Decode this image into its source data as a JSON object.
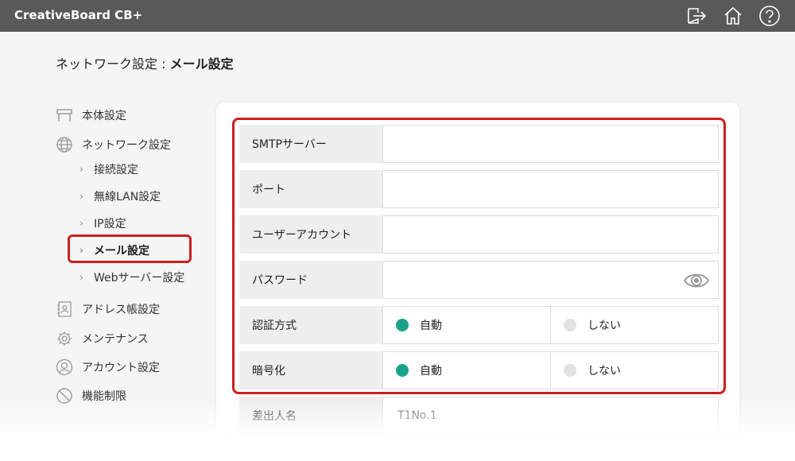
{
  "app": {
    "title": "CreativeBoard CB+"
  },
  "toolbar": {
    "icons": [
      "logout-icon",
      "home-icon",
      "help-icon"
    ]
  },
  "page": {
    "crumb": "ネットワーク設定 : ",
    "title": "メール設定"
  },
  "sidebar": {
    "items": [
      {
        "label": "本体設定",
        "icon": "display-icon"
      },
      {
        "label": "ネットワーク設定",
        "icon": "globe-icon"
      },
      {
        "label": "接続設定",
        "sub": true
      },
      {
        "label": "無線LAN設定",
        "sub": true
      },
      {
        "label": "IP設定",
        "sub": true
      },
      {
        "label": "メール設定",
        "sub": true,
        "active": true
      },
      {
        "label": "Webサーバー設定",
        "sub": true
      },
      {
        "label": "アドレス帳設定",
        "icon": "address-book-icon"
      },
      {
        "label": "メンテナンス",
        "icon": "gear-icon"
      },
      {
        "label": "アカウント設定",
        "icon": "user-icon"
      },
      {
        "label": "機能制限",
        "icon": "prohibited-icon"
      }
    ]
  },
  "form": {
    "smtp_label": "SMTPサーバー",
    "smtp_value": "",
    "port_label": "ポート",
    "port_value": "",
    "account_label": "ユーザーアカウント",
    "account_value": "",
    "password_label": "パスワード",
    "password_value": "",
    "auth_label": "認証方式",
    "auth_opt_auto": "自動",
    "auth_opt_none": "しない",
    "auth_selected": "自動",
    "enc_label": "暗号化",
    "enc_opt_auto": "自動",
    "enc_opt_none": "しない",
    "enc_selected": "自動",
    "sender_label": "差出人名",
    "sender_value": "T1No.1"
  },
  "colors": {
    "accent": "#1aa38a",
    "highlight": "#cc1f1f",
    "topbar": "#595959"
  }
}
